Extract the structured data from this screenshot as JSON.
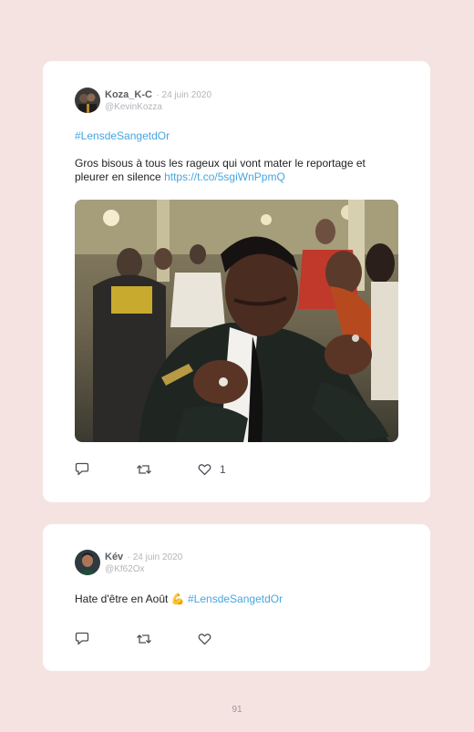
{
  "tweets": [
    {
      "name": "Koza_K-C",
      "date": "· 24 juin 2020",
      "handle": "@KevinKozza",
      "hashtag": "#LensdeSangetdOr",
      "text": "Gros bisous à tous les rageux qui vont mater le reportage et pleurer en silence ",
      "link": "https://t.co/5sgiWnPpmQ",
      "likes": "1"
    },
    {
      "name": "Kév",
      "date": "· 24 juin 2020",
      "handle": "@Kf62Ox",
      "text": "Hate d'être en Août ",
      "emoji": "💪",
      "hashtag": "#LensdeSangetdOr"
    }
  ],
  "page_number": "91"
}
